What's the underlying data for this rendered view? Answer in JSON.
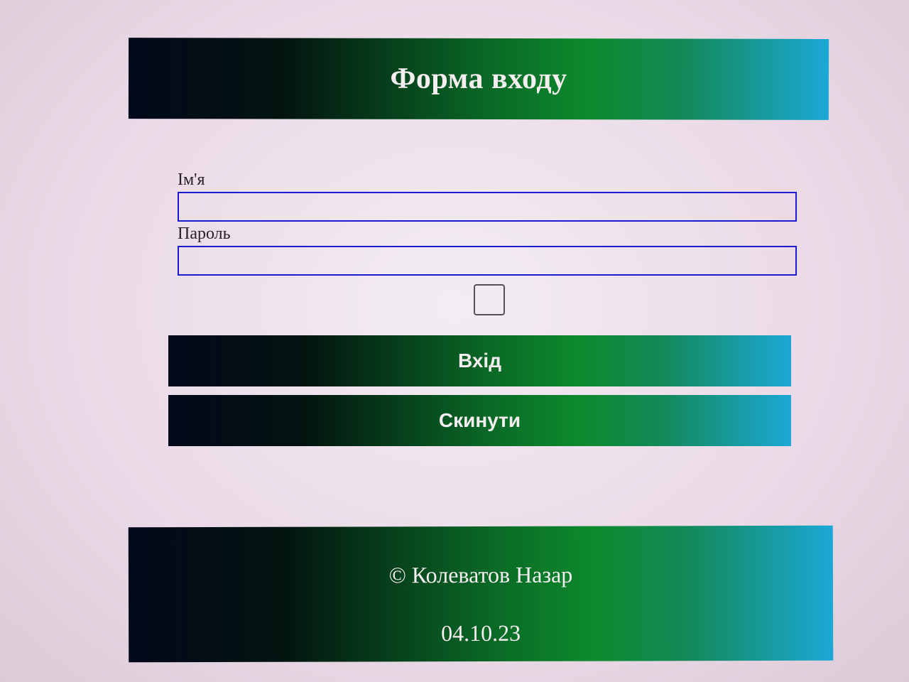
{
  "header": {
    "title": "Форма входу"
  },
  "form": {
    "name_label": "Ім'я",
    "name_value": "",
    "password_label": "Пароль",
    "password_value": "",
    "remember_checked": false,
    "login_label": "Вхід",
    "reset_label": "Скинути"
  },
  "footer": {
    "copyright": "© Колеватов Назар",
    "date": "04.10.23"
  },
  "colors": {
    "gradient_start": "#03081a",
    "gradient_mid": "#0c8a2c",
    "gradient_end": "#1ba8d6",
    "input_border": "#1b1bd0",
    "page_background": "#ead9e6"
  }
}
